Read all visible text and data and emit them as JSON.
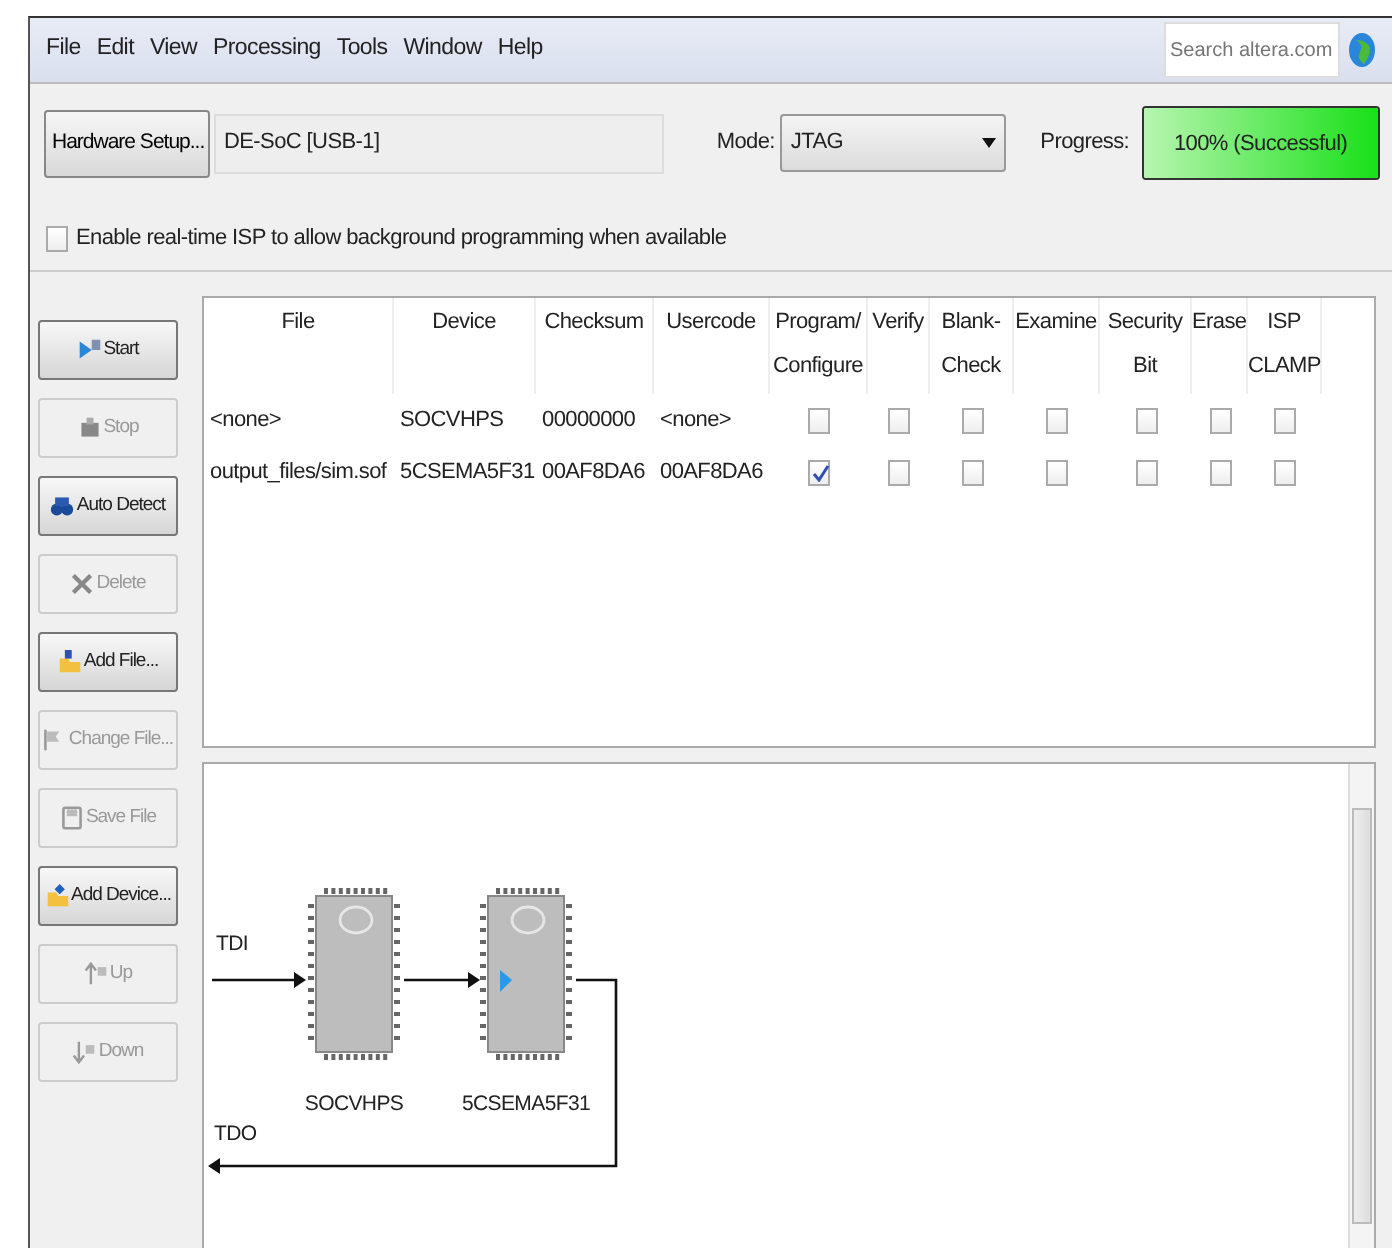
{
  "menu": [
    "File",
    "Edit",
    "View",
    "Processing",
    "Tools",
    "Window",
    "Help"
  ],
  "search": {
    "placeholder": "Search altera.com"
  },
  "hardware": {
    "button": "Hardware Setup...",
    "value": "DE-SoC [USB-1]"
  },
  "mode": {
    "label": "Mode:",
    "value": "JTAG"
  },
  "progress": {
    "label": "Progress:",
    "text": "100% (Successful)",
    "level": 1
  },
  "realtime_isp": {
    "label": "Enable real-time ISP to allow background programming when available",
    "checked": false
  },
  "side_buttons": [
    {
      "kind": "start",
      "label": "Start",
      "disabled": false
    },
    {
      "kind": "stop",
      "label": "Stop",
      "disabled": true
    },
    {
      "kind": "detect",
      "label": "Auto Detect",
      "disabled": false
    },
    {
      "kind": "delete",
      "label": "Delete",
      "disabled": true
    },
    {
      "kind": "add-file",
      "label": "Add File...",
      "disabled": false
    },
    {
      "kind": "change-file",
      "label": "Change File...",
      "disabled": true
    },
    {
      "kind": "save",
      "label": "Save File",
      "disabled": true
    },
    {
      "kind": "add-device",
      "label": "Add Device...",
      "disabled": false
    },
    {
      "kind": "up",
      "label": "Up",
      "disabled": true
    },
    {
      "kind": "down",
      "label": "Down",
      "disabled": true
    }
  ],
  "table": {
    "columns": [
      "File",
      "Device",
      "Checksum",
      "Usercode",
      "Program/\nConfigure",
      "Verify",
      "Blank-\nCheck",
      "Examine",
      "Security\nBit",
      "Erase",
      "ISP\nCLAMP"
    ],
    "rows": [
      {
        "file": "<none>",
        "device": "SOCVHPS",
        "checksum": "00000000",
        "usercode": "<none>",
        "checks": [
          false,
          false,
          false,
          false,
          false,
          false,
          false
        ]
      },
      {
        "file": "output_files/sim.sof",
        "device": "5CSEMA5F31",
        "checksum": "00AF8DA6",
        "usercode": "00AF8DA6",
        "checks": [
          true,
          false,
          false,
          false,
          false,
          false,
          false
        ]
      }
    ]
  },
  "chain": {
    "tdi": "TDI",
    "tdo": "TDO",
    "devices": [
      {
        "name": "SOCVHPS",
        "current": false
      },
      {
        "name": "5CSEMA5F31",
        "current": true
      }
    ]
  }
}
